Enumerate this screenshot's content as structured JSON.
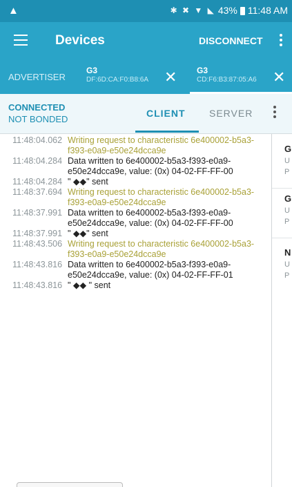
{
  "status_bar": {
    "left_icon": "warning-triangle-icon",
    "icons": "✱ ✖ ▼ ◣",
    "battery": "43%",
    "time": "11:48 AM"
  },
  "app_bar": {
    "title": "Devices",
    "disconnect_label": "DISCONNECT"
  },
  "device_tabs": {
    "advertiser_label": "ADVERTISER",
    "devices": [
      {
        "name": "G3",
        "address": "DF:6D:CA:F0:B8:6A",
        "close": "✕"
      },
      {
        "name": "G3",
        "address": "CD:F6:B3:87:05:A6",
        "close": "✕"
      }
    ]
  },
  "connection": {
    "state": "CONNECTED",
    "bond": "NOT BONDED",
    "tabs": [
      "CLIENT",
      "SERVER"
    ]
  },
  "log": [
    {
      "time": "11:48:04.062",
      "type": "warn",
      "message": "Writing request to characteristic 6e400002-b5a3-f393-e0a9-e50e24dcca9e"
    },
    {
      "time": "11:48:04.284",
      "type": "info",
      "message": "Data written to 6e400002-b5a3-f393-e0a9-e50e24dcca9e, value: (0x) 04-02-FF-FF-00"
    },
    {
      "time": "11:48:04.284",
      "type": "info",
      "message": "\" ◆◆\" sent"
    },
    {
      "time": "11:48:37.694",
      "type": "warn",
      "message": "Writing request to characteristic 6e400002-b5a3-f393-e0a9-e50e24dcca9e"
    },
    {
      "time": "11:48:37.991",
      "type": "info",
      "message": "Data written to 6e400002-b5a3-f393-e0a9-e50e24dcca9e, value: (0x) 04-02-FF-FF-00"
    },
    {
      "time": "11:48:37.991",
      "type": "info",
      "message": "\" ◆◆\" sent"
    },
    {
      "time": "11:48:43.506",
      "type": "warn",
      "message": "Writing request to characteristic 6e400002-b5a3-f393-e0a9-e50e24dcca9e"
    },
    {
      "time": "11:48:43.816",
      "type": "info",
      "message": "Data written to 6e400002-b5a3-f393-e0a9-e50e24dcca9e, value: (0x) 04-02-FF-FF-01"
    },
    {
      "time": "11:48:43.816",
      "type": "info",
      "message": "\" ◆◆ \" sent"
    }
  ],
  "services": [
    {
      "title": "G",
      "line1": "U",
      "line2": "P"
    },
    {
      "title": "G",
      "line1": "U",
      "line2": "P"
    },
    {
      "title": "N",
      "line1": "U",
      "line2": "P"
    }
  ],
  "colors": {
    "primary": "#2aa4c8",
    "status_bar": "#1e8fb3",
    "warn_text": "#a9a137"
  }
}
